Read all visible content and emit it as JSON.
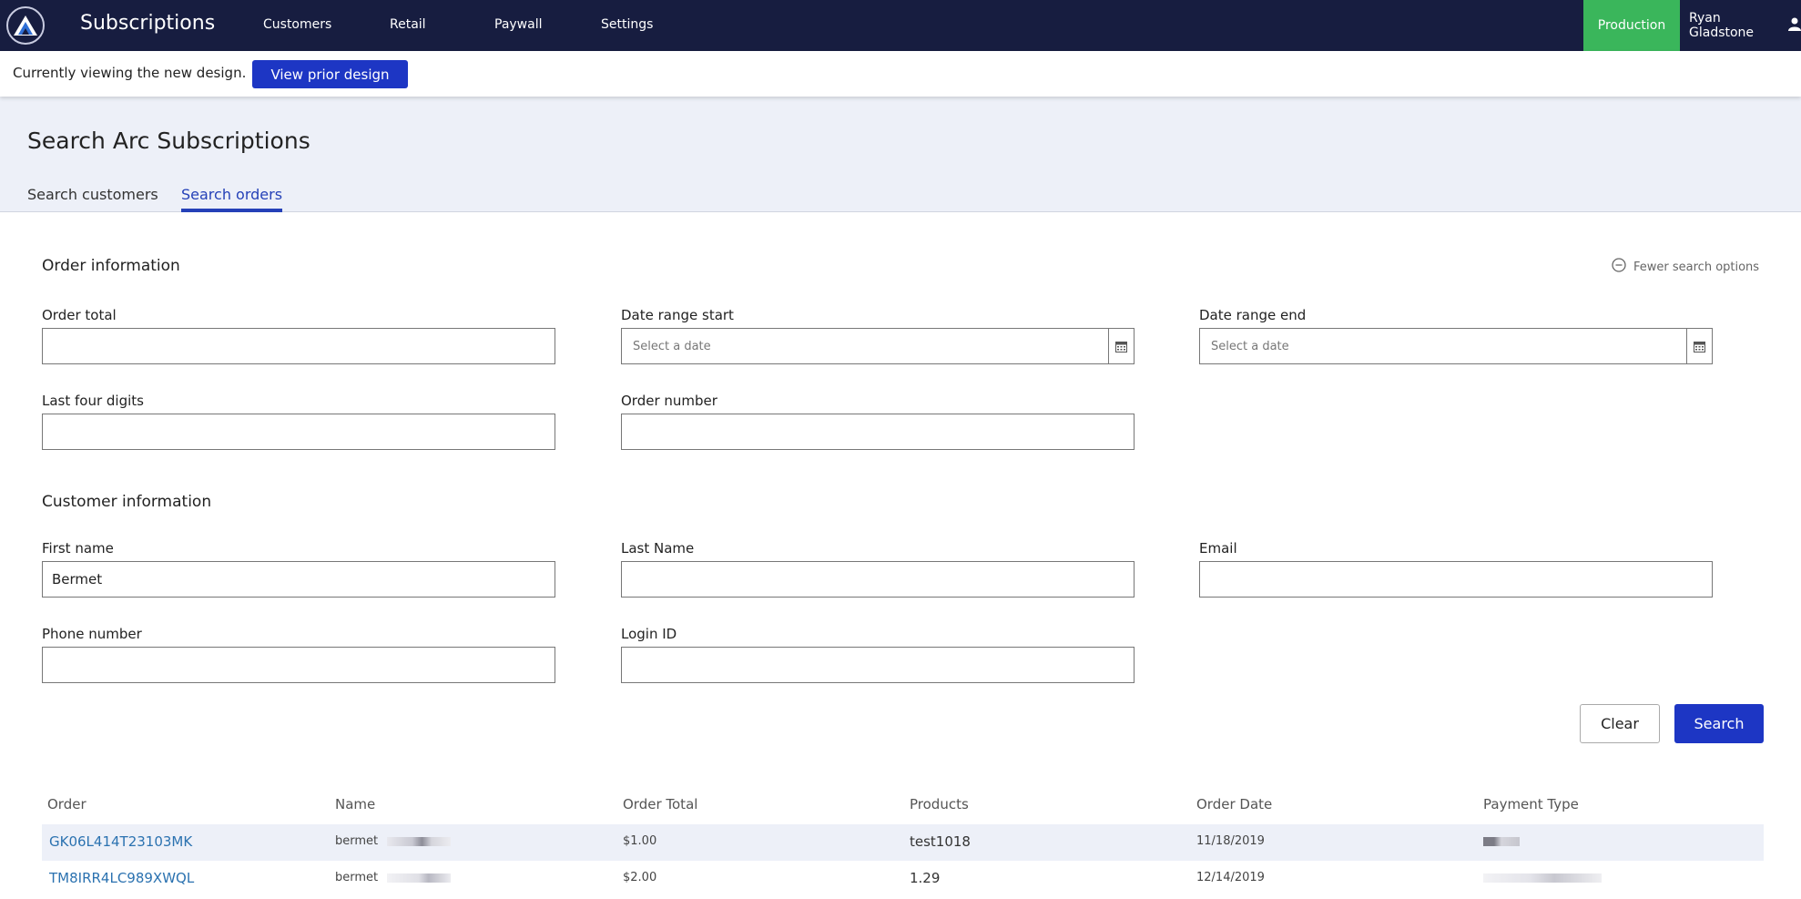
{
  "nav": {
    "app_title": "Subscriptions",
    "items": [
      "Customers",
      "Retail",
      "Paywall",
      "Settings"
    ],
    "environment": "Production",
    "user_name": "Ryan Gladstone"
  },
  "banner": {
    "text": "Currently viewing the new design.",
    "button_label": "View prior design"
  },
  "header": {
    "page_title": "Search Arc Subscriptions",
    "tabs": [
      "Search customers",
      "Search orders"
    ],
    "active_tab": "Search orders"
  },
  "order_info": {
    "title": "Order information",
    "fewer_options_label": "Fewer search options",
    "order_total": {
      "label": "Order total",
      "value": ""
    },
    "date_start": {
      "label": "Date range start",
      "placeholder": "Select a date"
    },
    "date_end": {
      "label": "Date range end",
      "placeholder": "Select a date"
    },
    "last_four": {
      "label": "Last four digits",
      "value": ""
    },
    "order_number": {
      "label": "Order number",
      "value": ""
    }
  },
  "customer_info": {
    "title": "Customer information",
    "first_name": {
      "label": "First name",
      "value": "Bermet"
    },
    "last_name": {
      "label": "Last Name",
      "value": ""
    },
    "email": {
      "label": "Email",
      "value": ""
    },
    "phone": {
      "label": "Phone number",
      "value": ""
    },
    "login_id": {
      "label": "Login ID",
      "value": ""
    }
  },
  "actions": {
    "clear_label": "Clear",
    "search_label": "Search"
  },
  "results": {
    "columns": [
      "Order",
      "Name",
      "Order Total",
      "Products",
      "Order Date",
      "Payment Type"
    ],
    "rows": [
      {
        "order": "GK06L414T23103MK",
        "name": "bermet",
        "total": "$1.00",
        "products": "test1018",
        "date": "11/18/2019"
      },
      {
        "order": "TM8IRR4LC989XWQL",
        "name": "bermet",
        "total": "$2.00",
        "products": "1.29",
        "date": "12/14/2019"
      }
    ]
  },
  "colors": {
    "nav_bg": "#171d40",
    "primary": "#1d36c4",
    "production": "#3ab65b",
    "link": "#2b72b0",
    "header_bg": "#edf0f8"
  }
}
